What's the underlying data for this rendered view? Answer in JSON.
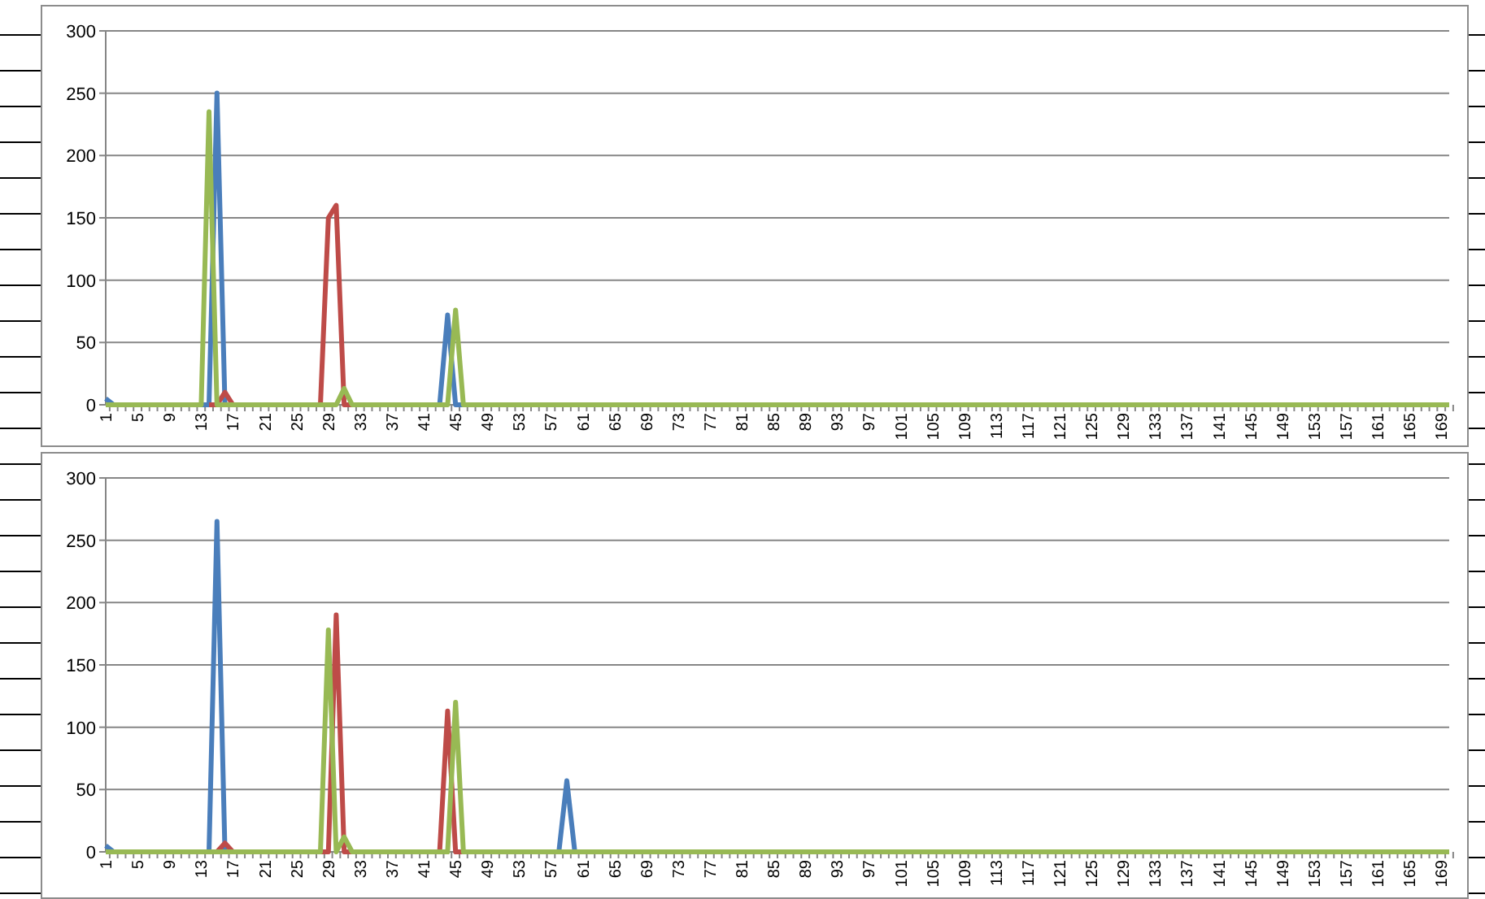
{
  "charts": [
    {
      "chart_data": {
        "type": "line",
        "grid": true,
        "xlim": [
          1,
          170
        ],
        "ylim": [
          0,
          300
        ],
        "yticks": [
          0,
          50,
          100,
          150,
          200,
          250,
          300
        ],
        "xticks": [
          1,
          5,
          9,
          13,
          17,
          21,
          25,
          29,
          33,
          37,
          41,
          45,
          49,
          53,
          57,
          61,
          65,
          69,
          73,
          77,
          81,
          85,
          89,
          93,
          97,
          101,
          105,
          109,
          113,
          117,
          121,
          125,
          129,
          133,
          137,
          141,
          145,
          149,
          153,
          157,
          161,
          165,
          169
        ],
        "x": [
          1,
          2,
          3,
          4,
          5,
          6,
          7,
          8,
          9,
          10,
          11,
          12,
          13,
          14,
          15,
          16,
          17,
          18,
          19,
          20,
          21,
          22,
          23,
          24,
          25,
          26,
          27,
          28,
          29,
          30,
          31,
          32,
          33,
          34,
          35,
          36,
          37,
          38,
          39,
          40,
          41,
          42,
          43,
          44,
          45,
          46,
          47,
          48,
          49,
          50,
          51,
          52,
          53,
          54,
          55,
          56,
          57,
          58,
          59,
          60,
          61,
          62,
          63,
          64,
          65,
          66,
          67,
          68,
          69,
          70,
          71,
          72,
          73,
          74,
          75,
          76,
          77,
          78,
          79,
          80,
          81,
          82,
          83,
          84,
          85,
          86,
          87,
          88,
          89,
          90,
          91,
          92,
          93,
          94,
          95,
          96,
          97,
          98,
          99,
          100,
          101,
          102,
          103,
          104,
          105,
          106,
          107,
          108,
          109,
          110,
          111,
          112,
          113,
          114,
          115,
          116,
          117,
          118,
          119,
          120,
          121,
          122,
          123,
          124,
          125,
          126,
          127,
          128,
          129,
          130,
          131,
          132,
          133,
          134,
          135,
          136,
          137,
          138,
          139,
          140,
          141,
          142,
          143,
          144,
          145,
          146,
          147,
          148,
          149,
          150,
          151,
          152,
          153,
          154,
          155,
          156,
          157,
          158,
          159,
          160,
          161,
          162,
          163,
          164,
          165,
          166,
          167,
          168,
          169,
          170
        ],
        "series": [
          {
            "color": "#4a7ebb",
            "values": [
              5,
              0,
              0,
              null,
              null,
              null,
              null,
              null,
              null,
              null,
              null,
              null,
              0,
              0,
              250,
              0,
              0,
              null,
              null,
              null,
              null,
              null,
              null,
              null,
              null,
              null,
              null,
              null,
              null,
              null,
              null,
              null,
              null,
              null,
              null,
              null,
              null,
              null,
              null,
              null,
              null,
              0,
              0,
              72,
              0,
              0,
              null,
              null,
              null,
              null,
              null,
              null,
              null,
              null,
              null,
              null,
              null,
              null,
              null,
              null,
              null,
              null,
              null,
              null,
              null,
              null,
              null,
              null,
              null,
              null,
              null,
              null,
              null,
              null,
              null,
              null,
              null,
              null,
              null,
              null,
              null,
              null,
              null,
              null,
              null,
              null,
              null,
              null,
              null,
              null,
              null,
              null,
              null,
              null,
              null,
              null,
              null,
              null,
              null,
              null,
              null,
              null,
              null,
              null,
              null,
              null,
              null,
              null,
              null,
              null,
              null,
              null,
              null,
              null,
              null,
              null,
              null,
              null,
              null,
              null,
              null,
              null,
              null,
              null,
              null,
              null,
              null,
              null,
              null,
              null,
              null,
              null,
              null,
              null,
              null,
              null,
              null,
              null,
              null,
              null,
              null,
              null,
              null,
              null,
              null,
              null,
              null,
              null,
              null,
              null,
              null,
              null,
              null,
              null,
              null,
              null,
              null,
              null,
              null,
              null,
              null,
              null,
              null,
              null,
              null,
              null,
              null,
              null,
              null,
              null
            ]
          },
          {
            "color": "#be4b48",
            "values": [
              null,
              null,
              null,
              null,
              null,
              null,
              null,
              null,
              null,
              null,
              null,
              null,
              null,
              0,
              0,
              10,
              0,
              0,
              null,
              null,
              null,
              null,
              null,
              null,
              null,
              null,
              0,
              0,
              150,
              160,
              0,
              0,
              null,
              null,
              null,
              null,
              null,
              null,
              null,
              null,
              null,
              null,
              null,
              null,
              null,
              null,
              null,
              null,
              null,
              null,
              null,
              null,
              null,
              null,
              null,
              null,
              null,
              null,
              null,
              null,
              null,
              null,
              null,
              null,
              null,
              null,
              null,
              null,
              null,
              null,
              null,
              null,
              null,
              null,
              null,
              null,
              null,
              null,
              null,
              null,
              null,
              null,
              null,
              null,
              null,
              null,
              null,
              null,
              null,
              null,
              null,
              null,
              null,
              null,
              null,
              null,
              null,
              null,
              null,
              null,
              null,
              null,
              null,
              null,
              null,
              null,
              null,
              null,
              null,
              null,
              null,
              null,
              null,
              null,
              null,
              null,
              null,
              null,
              null,
              null,
              null,
              null,
              null,
              null,
              null,
              null,
              null,
              null,
              null,
              null,
              null,
              null,
              null,
              null,
              null,
              null,
              null,
              null,
              null,
              null,
              null,
              null,
              null,
              null,
              null,
              null,
              null,
              null,
              null,
              null,
              null,
              null,
              null,
              null,
              null,
              null,
              null,
              null,
              null,
              null,
              null,
              null,
              null,
              null,
              null,
              null,
              null,
              null,
              null,
              null
            ]
          },
          {
            "color": "#98b954",
            "values": [
              0,
              0,
              0,
              0,
              0,
              0,
              0,
              0,
              0,
              0,
              0,
              0,
              0,
              235,
              0,
              0,
              0,
              0,
              0,
              0,
              0,
              0,
              0,
              0,
              0,
              0,
              0,
              0,
              0,
              0,
              13,
              0,
              0,
              0,
              0,
              0,
              0,
              0,
              0,
              0,
              0,
              0,
              0,
              0,
              76,
              0,
              0,
              0,
              0,
              0,
              0,
              0,
              0,
              0,
              0,
              0,
              0,
              0,
              0,
              0,
              0,
              0,
              0,
              0,
              0,
              0,
              0,
              0,
              0,
              0,
              0,
              0,
              0,
              0,
              0,
              0,
              0,
              0,
              0,
              0,
              0,
              0,
              0,
              0,
              0,
              0,
              0,
              0,
              0,
              0,
              0,
              0,
              0,
              0,
              0,
              0,
              0,
              0,
              0,
              0,
              0,
              0,
              0,
              0,
              0,
              0,
              0,
              0,
              0,
              0,
              0,
              0,
              0,
              0,
              0,
              0,
              0,
              0,
              0,
              0,
              0,
              0,
              0,
              0,
              0,
              0,
              0,
              0,
              0,
              0,
              0,
              0,
              0,
              0,
              0,
              0,
              0,
              0,
              0,
              0,
              0,
              0,
              0,
              0,
              0,
              0,
              0,
              0,
              0,
              0,
              0,
              0,
              0,
              0,
              0,
              0,
              0,
              0,
              0,
              0,
              0,
              0,
              0,
              0,
              0,
              0,
              0,
              0,
              0,
              0
            ]
          }
        ]
      }
    },
    {
      "chart_data": {
        "type": "line",
        "grid": true,
        "xlim": [
          1,
          170
        ],
        "ylim": [
          0,
          300
        ],
        "yticks": [
          0,
          50,
          100,
          150,
          200,
          250,
          300
        ],
        "xticks": [
          1,
          5,
          9,
          13,
          17,
          21,
          25,
          29,
          33,
          37,
          41,
          45,
          49,
          53,
          57,
          61,
          65,
          69,
          73,
          77,
          81,
          85,
          89,
          93,
          97,
          101,
          105,
          109,
          113,
          117,
          121,
          125,
          129,
          133,
          137,
          141,
          145,
          149,
          153,
          157,
          161,
          165,
          169
        ],
        "x": [
          1,
          2,
          3,
          4,
          5,
          6,
          7,
          8,
          9,
          10,
          11,
          12,
          13,
          14,
          15,
          16,
          17,
          18,
          19,
          20,
          21,
          22,
          23,
          24,
          25,
          26,
          27,
          28,
          29,
          30,
          31,
          32,
          33,
          34,
          35,
          36,
          37,
          38,
          39,
          40,
          41,
          42,
          43,
          44,
          45,
          46,
          47,
          48,
          49,
          50,
          51,
          52,
          53,
          54,
          55,
          56,
          57,
          58,
          59,
          60,
          61,
          62,
          63,
          64,
          65,
          66,
          67,
          68,
          69,
          70,
          71,
          72,
          73,
          74,
          75,
          76,
          77,
          78,
          79,
          80,
          81,
          82,
          83,
          84,
          85,
          86,
          87,
          88,
          89,
          90,
          91,
          92,
          93,
          94,
          95,
          96,
          97,
          98,
          99,
          100,
          101,
          102,
          103,
          104,
          105,
          106,
          107,
          108,
          109,
          110,
          111,
          112,
          113,
          114,
          115,
          116,
          117,
          118,
          119,
          120,
          121,
          122,
          123,
          124,
          125,
          126,
          127,
          128,
          129,
          130,
          131,
          132,
          133,
          134,
          135,
          136,
          137,
          138,
          139,
          140,
          141,
          142,
          143,
          144,
          145,
          146,
          147,
          148,
          149,
          150,
          151,
          152,
          153,
          154,
          155,
          156,
          157,
          158,
          159,
          160,
          161,
          162,
          163,
          164,
          165,
          166,
          167,
          168,
          169,
          170
        ],
        "series": [
          {
            "color": "#4a7ebb",
            "values": [
              5,
              0,
              0,
              null,
              null,
              null,
              null,
              null,
              null,
              null,
              null,
              null,
              0,
              0,
              265,
              0,
              0,
              null,
              null,
              null,
              null,
              null,
              null,
              null,
              null,
              null,
              null,
              null,
              null,
              null,
              null,
              null,
              null,
              null,
              null,
              null,
              null,
              null,
              null,
              null,
              null,
              null,
              null,
              null,
              null,
              null,
              null,
              null,
              null,
              null,
              null,
              null,
              null,
              null,
              null,
              null,
              0,
              0,
              57,
              0,
              0,
              null,
              null,
              null,
              null,
              null,
              null,
              null,
              null,
              null,
              null,
              null,
              null,
              null,
              null,
              null,
              null,
              null,
              null,
              null,
              null,
              null,
              null,
              null,
              null,
              null,
              null,
              null,
              null,
              null,
              null,
              null,
              null,
              null,
              null,
              null,
              null,
              null,
              null,
              null,
              null,
              null,
              null,
              null,
              null,
              null,
              null,
              null,
              null,
              null,
              null,
              null,
              null,
              null,
              null,
              null,
              null,
              null,
              null,
              null,
              null,
              null,
              null,
              null,
              null,
              null,
              null,
              null,
              null,
              null,
              null,
              null,
              null,
              null,
              null,
              null,
              null,
              null,
              null,
              null,
              null,
              null,
              null,
              null,
              null,
              null,
              null,
              null,
              null,
              null,
              null,
              null,
              null,
              null,
              null,
              null,
              null,
              null,
              null,
              null,
              null,
              null,
              null,
              null,
              null,
              null,
              null,
              null,
              null,
              null
            ]
          },
          {
            "color": "#be4b48",
            "values": [
              null,
              null,
              null,
              null,
              null,
              null,
              null,
              null,
              null,
              null,
              null,
              null,
              null,
              0,
              0,
              7,
              0,
              0,
              null,
              null,
              null,
              null,
              null,
              null,
              null,
              null,
              null,
              0,
              0,
              190,
              0,
              0,
              null,
              null,
              null,
              null,
              null,
              null,
              null,
              null,
              null,
              0,
              0,
              113,
              0,
              0,
              null,
              null,
              null,
              null,
              null,
              null,
              null,
              null,
              null,
              null,
              null,
              null,
              null,
              null,
              null,
              null,
              null,
              null,
              null,
              null,
              null,
              null,
              null,
              null,
              null,
              null,
              null,
              null,
              null,
              null,
              null,
              null,
              null,
              null,
              null,
              null,
              null,
              null,
              null,
              null,
              null,
              null,
              null,
              null,
              null,
              null,
              null,
              null,
              null,
              null,
              null,
              null,
              null,
              null,
              null,
              null,
              null,
              null,
              null,
              null,
              null,
              null,
              null,
              null,
              null,
              null,
              null,
              null,
              null,
              null,
              null,
              null,
              null,
              null,
              null,
              null,
              null,
              null,
              null,
              null,
              null,
              null,
              null,
              null,
              null,
              null,
              null,
              null,
              null,
              null,
              null,
              null,
              null,
              null,
              null,
              null,
              null,
              null,
              null,
              null,
              null,
              null,
              null,
              null,
              null,
              null,
              null,
              null,
              null,
              null,
              null,
              null,
              null,
              null,
              null,
              null,
              null,
              null,
              null,
              null,
              null,
              null,
              null,
              null
            ]
          },
          {
            "color": "#98b954",
            "values": [
              0,
              0,
              0,
              0,
              0,
              0,
              0,
              0,
              0,
              0,
              0,
              0,
              0,
              0,
              0,
              0,
              0,
              0,
              0,
              0,
              0,
              0,
              0,
              0,
              0,
              0,
              0,
              0,
              178,
              0,
              12,
              0,
              0,
              0,
              0,
              0,
              0,
              0,
              0,
              0,
              0,
              0,
              0,
              0,
              120,
              0,
              0,
              0,
              0,
              0,
              0,
              0,
              0,
              0,
              0,
              0,
              0,
              0,
              0,
              0,
              0,
              0,
              0,
              0,
              0,
              0,
              0,
              0,
              0,
              0,
              0,
              0,
              0,
              0,
              0,
              0,
              0,
              0,
              0,
              0,
              0,
              0,
              0,
              0,
              0,
              0,
              0,
              0,
              0,
              0,
              0,
              0,
              0,
              0,
              0,
              0,
              0,
              0,
              0,
              0,
              0,
              0,
              0,
              0,
              0,
              0,
              0,
              0,
              0,
              0,
              0,
              0,
              0,
              0,
              0,
              0,
              0,
              0,
              0,
              0,
              0,
              0,
              0,
              0,
              0,
              0,
              0,
              0,
              0,
              0,
              0,
              0,
              0,
              0,
              0,
              0,
              0,
              0,
              0,
              0,
              0,
              0,
              0,
              0,
              0,
              0,
              0,
              0,
              0,
              0,
              0,
              0,
              0,
              0,
              0,
              0,
              0,
              0,
              0,
              0,
              0,
              0,
              0,
              0,
              0,
              0,
              0,
              0,
              0,
              0
            ]
          }
        ]
      }
    }
  ]
}
